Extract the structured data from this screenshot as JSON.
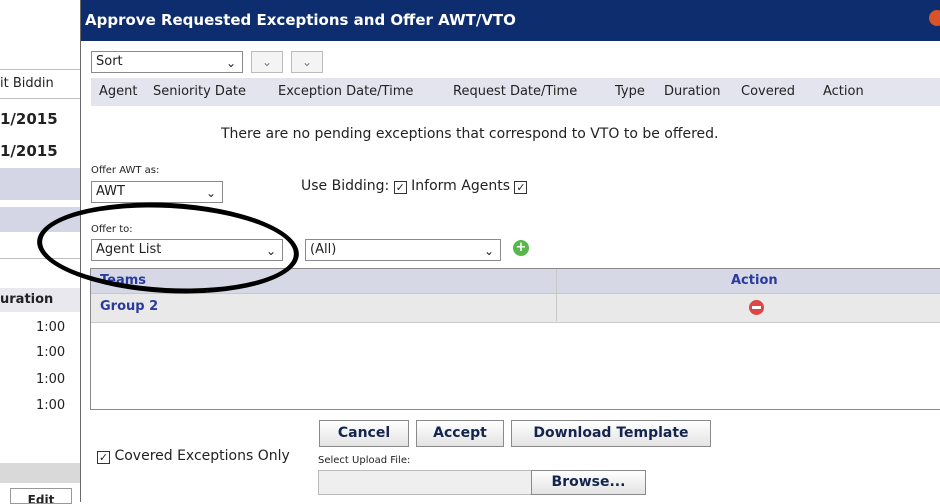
{
  "background_page": {
    "col_label": "it Biddin",
    "date1": "1/2015",
    "date2": "1/2015",
    "duration_header": "uration",
    "durations": [
      "1:00",
      "1:00",
      "1:00",
      "1:00"
    ],
    "edit_label": "Edit"
  },
  "dialog": {
    "title": "Approve Requested Exceptions and Offer AWT/VTO",
    "sort": {
      "selected": "Sort"
    },
    "columns": [
      "Agent",
      "Seniority Date",
      "Exception Date/Time",
      "Request Date/Time",
      "Type",
      "Duration",
      "Covered",
      "Action"
    ],
    "empty_message": "There are no pending exceptions that correspond to VTO to be offered.",
    "offer_awt": {
      "label": "Offer AWT as:",
      "selected": "AWT"
    },
    "use_bidding": {
      "label": "Use Bidding:",
      "checked": true
    },
    "inform_agents": {
      "label": "Inform Agents",
      "checked": true
    },
    "offer_to": {
      "label": "Offer to:",
      "selected": "Agent List"
    },
    "team_filter": {
      "selected": "(All)"
    },
    "grid": {
      "headers": [
        "Teams",
        "Action"
      ],
      "rows": [
        {
          "team": "Group 2"
        }
      ]
    },
    "covered_only": {
      "label": "Covered Exceptions Only",
      "checked": true
    },
    "buttons": {
      "cancel": "Cancel",
      "accept": "Accept",
      "download": "Download Template",
      "browse": "Browse..."
    },
    "upload_label": "Select Upload File:"
  },
  "colors": {
    "title_bg": "#0d2d6e",
    "header_bg": "#e3e4ee",
    "link": "#2b3a9e",
    "add": "#56b84b",
    "remove": "#e04545"
  },
  "icons": [
    "chevron-down-icon",
    "add-icon",
    "remove-icon",
    "close-icon",
    "checkbox-checked-icon"
  ]
}
